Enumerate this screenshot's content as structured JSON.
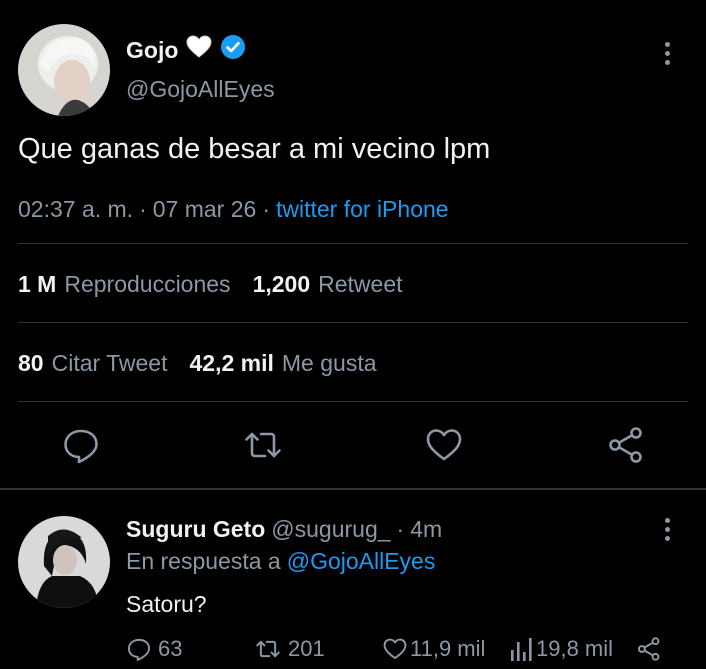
{
  "tweet": {
    "display_name": "Gojo",
    "handle": "@GojoAllEyes",
    "text": "Que ganas de besar a mi vecino lpm",
    "time": "02:37 a. m.",
    "date": "07 mar 26",
    "source": "twitter for iPhone",
    "dot": "·"
  },
  "stats": {
    "views_count": "1 M",
    "views_label": "Reproducciones",
    "retweets_count": "1,200",
    "retweets_label": "Retweet",
    "quotes_count": "80",
    "quotes_label": "Citar Tweet",
    "likes_count": "42,2 mil",
    "likes_label": "Me gusta"
  },
  "reply": {
    "display_name": "Suguru Geto",
    "handle": "@sugurug_",
    "dot": "·",
    "time": "4m",
    "reply_prefix": "En respuesta a",
    "reply_mention": "@GojoAllEyes",
    "text": "Satoru?",
    "replies": "63",
    "retweets": "201",
    "likes": "11,9 mil",
    "views": "19,8 mil"
  },
  "colors": {
    "background": "#000000",
    "muted": "#8b98a5",
    "link": "#1d9bf0",
    "divider": "#2f3336",
    "verified": "#1d9bf0"
  },
  "icons": [
    "verified-badge-icon",
    "white-heart-emoji",
    "more-vertical-icon",
    "reply-icon",
    "retweet-icon",
    "like-icon",
    "share-icon",
    "views-icon"
  ]
}
